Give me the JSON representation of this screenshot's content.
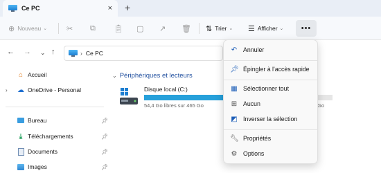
{
  "window": {
    "tab_title": "Ce PC",
    "close_icon": "×",
    "new_tab_icon": "+"
  },
  "toolbar": {
    "new_label": "Nouveau",
    "sort_label": "Trier",
    "view_label": "Afficher",
    "more_label": "•••"
  },
  "address": {
    "location": "Ce PC"
  },
  "sidebar": {
    "items": [
      {
        "label": "Accueil",
        "icon": "home-icon"
      },
      {
        "label": "OneDrive - Personal",
        "icon": "cloud-icon"
      },
      {
        "label": "Bureau",
        "icon": "desktop-folder-icon"
      },
      {
        "label": "Téléchargements",
        "icon": "download-folder-icon"
      },
      {
        "label": "Documents",
        "icon": "documents-folder-icon"
      },
      {
        "label": "Images",
        "icon": "pictures-folder-icon"
      }
    ]
  },
  "main": {
    "group_title": "Périphériques et lecteurs",
    "drive": {
      "name": "Disque local (C:)",
      "free_text": "54,4 Go libres sur 465 Go",
      "used_fraction": 0.883,
      "partial_text": "Go"
    }
  },
  "menu": {
    "items": [
      {
        "label": "Annuler",
        "icon": "undo-icon"
      },
      {
        "label": "Épingler à l'accès rapide",
        "icon": "pin-icon"
      },
      {
        "label": "Sélectionner tout",
        "icon": "select-all-icon"
      },
      {
        "label": "Aucun",
        "icon": "select-none-icon"
      },
      {
        "label": "Inverser la sélection",
        "icon": "invert-selection-icon"
      },
      {
        "label": "Propriétés",
        "icon": "properties-icon"
      },
      {
        "label": "Options",
        "icon": "options-gear-icon"
      }
    ]
  },
  "colors": {
    "accent": "#26a0da",
    "group_header": "#1f4e9e",
    "menu_icon": "#1f5fb8"
  }
}
